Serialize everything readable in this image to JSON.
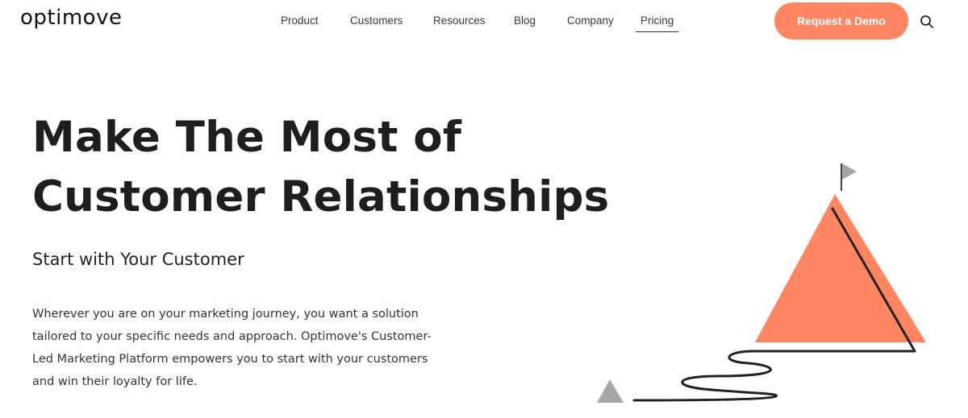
{
  "header": {
    "logo_text": "optimove",
    "nav": [
      {
        "label": "Product",
        "active": false
      },
      {
        "label": "Customers",
        "active": false
      },
      {
        "label": "Resources",
        "active": false
      },
      {
        "label": "Blog",
        "active": false
      },
      {
        "label": "Company",
        "active": false
      },
      {
        "label": "Pricing",
        "active": true
      }
    ],
    "cta_label": "Request a Demo",
    "search_icon": "search-icon"
  },
  "hero": {
    "headline_line1": "Make The Most of",
    "headline_line2": "Customer Relationships",
    "subheadline": "Start with Your Customer",
    "body": "Wherever you are on your marketing journey, you want a solution tailored to your specific needs and approach. Optimove's Customer-Led Marketing Platform empowers you to start with your customers and win their loyalty for life."
  },
  "colors": {
    "accent": "#ff8661",
    "text": "#1e1e1e",
    "flag_gray": "#a5a5a7"
  },
  "illustration": {
    "icons": [
      "mountain-icon",
      "flag-icon",
      "small-triangle-icon",
      "winding-path-icon"
    ]
  }
}
